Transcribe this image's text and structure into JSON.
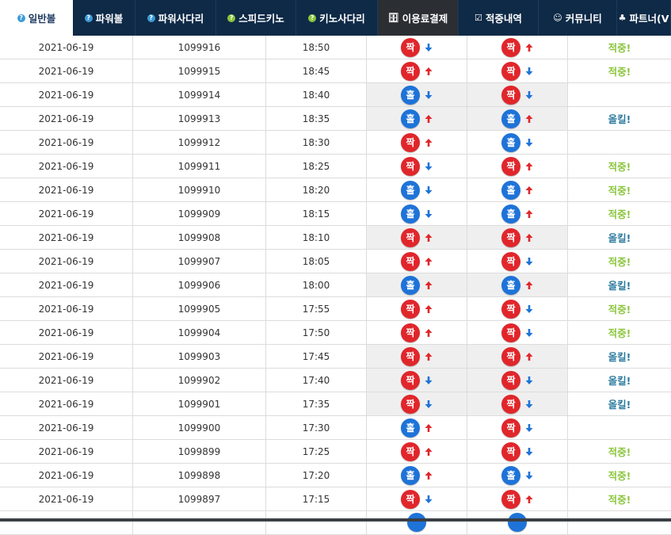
{
  "nav": {
    "tabs": [
      {
        "label": "일반볼",
        "icon": "help-circle-icon",
        "glyph": "?",
        "style": "active"
      },
      {
        "label": "파워볼",
        "icon": "help-circle-icon",
        "glyph": "?",
        "style": "normal"
      },
      {
        "label": "파워사다리",
        "icon": "help-circle-icon",
        "glyph": "?",
        "style": "normal"
      },
      {
        "label": "스피드키노",
        "icon": "help-circle-icon",
        "glyph": "?",
        "style": "normal"
      },
      {
        "label": "키노사다리",
        "icon": "help-circle-icon",
        "glyph": "?",
        "style": "normal"
      },
      {
        "label": "이용료결제",
        "icon": "database-icon",
        "glyph": "🗄",
        "style": "dark"
      },
      {
        "label": "적중내역",
        "icon": "checkbox-icon",
        "glyph": "☑",
        "style": "normal"
      },
      {
        "label": "커뮤니티",
        "icon": "smiley-icon",
        "glyph": "☺",
        "style": "normal"
      },
      {
        "label": "파트너(V",
        "icon": "group-icon",
        "glyph": "♣",
        "style": "normal"
      }
    ]
  },
  "rows": [
    {
      "date": "2021-06-19",
      "round": "1099916",
      "time": "18:50",
      "p1": "짝",
      "p1_color": "red",
      "p1_arrow": "down",
      "p2": "짝",
      "p2_color": "red",
      "p2_arrow": "up",
      "result": "적중!",
      "result_type": "hit",
      "shaded": false
    },
    {
      "date": "2021-06-19",
      "round": "1099915",
      "time": "18:45",
      "p1": "짝",
      "p1_color": "red",
      "p1_arrow": "up",
      "p2": "짝",
      "p2_color": "red",
      "p2_arrow": "down",
      "result": "적중!",
      "result_type": "hit",
      "shaded": false
    },
    {
      "date": "2021-06-19",
      "round": "1099914",
      "time": "18:40",
      "p1": "홀",
      "p1_color": "blue",
      "p1_arrow": "down",
      "p2": "짝",
      "p2_color": "red",
      "p2_arrow": "down",
      "result": "",
      "result_type": "none",
      "shaded": true
    },
    {
      "date": "2021-06-19",
      "round": "1099913",
      "time": "18:35",
      "p1": "홀",
      "p1_color": "blue",
      "p1_arrow": "up",
      "p2": "홀",
      "p2_color": "blue",
      "p2_arrow": "up",
      "result": "올킬!",
      "result_type": "allkill",
      "shaded": true
    },
    {
      "date": "2021-06-19",
      "round": "1099912",
      "time": "18:30",
      "p1": "짝",
      "p1_color": "red",
      "p1_arrow": "up",
      "p2": "홀",
      "p2_color": "blue",
      "p2_arrow": "down",
      "result": "",
      "result_type": "none",
      "shaded": false
    },
    {
      "date": "2021-06-19",
      "round": "1099911",
      "time": "18:25",
      "p1": "짝",
      "p1_color": "red",
      "p1_arrow": "down",
      "p2": "짝",
      "p2_color": "red",
      "p2_arrow": "up",
      "result": "적중!",
      "result_type": "hit",
      "shaded": false
    },
    {
      "date": "2021-06-19",
      "round": "1099910",
      "time": "18:20",
      "p1": "홀",
      "p1_color": "blue",
      "p1_arrow": "down",
      "p2": "홀",
      "p2_color": "blue",
      "p2_arrow": "up",
      "result": "적중!",
      "result_type": "hit",
      "shaded": false
    },
    {
      "date": "2021-06-19",
      "round": "1099909",
      "time": "18:15",
      "p1": "홀",
      "p1_color": "blue",
      "p1_arrow": "down",
      "p2": "홀",
      "p2_color": "blue",
      "p2_arrow": "up",
      "result": "적중!",
      "result_type": "hit",
      "shaded": false
    },
    {
      "date": "2021-06-19",
      "round": "1099908",
      "time": "18:10",
      "p1": "짝",
      "p1_color": "red",
      "p1_arrow": "up",
      "p2": "짝",
      "p2_color": "red",
      "p2_arrow": "up",
      "result": "올킬!",
      "result_type": "allkill",
      "shaded": true
    },
    {
      "date": "2021-06-19",
      "round": "1099907",
      "time": "18:05",
      "p1": "짝",
      "p1_color": "red",
      "p1_arrow": "up",
      "p2": "짝",
      "p2_color": "red",
      "p2_arrow": "down",
      "result": "적중!",
      "result_type": "hit",
      "shaded": false
    },
    {
      "date": "2021-06-19",
      "round": "1099906",
      "time": "18:00",
      "p1": "홀",
      "p1_color": "blue",
      "p1_arrow": "up",
      "p2": "홀",
      "p2_color": "blue",
      "p2_arrow": "up",
      "result": "올킬!",
      "result_type": "allkill",
      "shaded": true
    },
    {
      "date": "2021-06-19",
      "round": "1099905",
      "time": "17:55",
      "p1": "짝",
      "p1_color": "red",
      "p1_arrow": "up",
      "p2": "짝",
      "p2_color": "red",
      "p2_arrow": "down",
      "result": "적중!",
      "result_type": "hit",
      "shaded": false
    },
    {
      "date": "2021-06-19",
      "round": "1099904",
      "time": "17:50",
      "p1": "짝",
      "p1_color": "red",
      "p1_arrow": "up",
      "p2": "짝",
      "p2_color": "red",
      "p2_arrow": "down",
      "result": "적중!",
      "result_type": "hit",
      "shaded": false
    },
    {
      "date": "2021-06-19",
      "round": "1099903",
      "time": "17:45",
      "p1": "짝",
      "p1_color": "red",
      "p1_arrow": "up",
      "p2": "짝",
      "p2_color": "red",
      "p2_arrow": "up",
      "result": "올킬!",
      "result_type": "allkill",
      "shaded": true
    },
    {
      "date": "2021-06-19",
      "round": "1099902",
      "time": "17:40",
      "p1": "짝",
      "p1_color": "red",
      "p1_arrow": "down",
      "p2": "짝",
      "p2_color": "red",
      "p2_arrow": "down",
      "result": "올킬!",
      "result_type": "allkill",
      "shaded": true
    },
    {
      "date": "2021-06-19",
      "round": "1099901",
      "time": "17:35",
      "p1": "짝",
      "p1_color": "red",
      "p1_arrow": "down",
      "p2": "짝",
      "p2_color": "red",
      "p2_arrow": "down",
      "result": "올킬!",
      "result_type": "allkill",
      "shaded": true
    },
    {
      "date": "2021-06-19",
      "round": "1099900",
      "time": "17:30",
      "p1": "홀",
      "p1_color": "blue",
      "p1_arrow": "up",
      "p2": "짝",
      "p2_color": "red",
      "p2_arrow": "down",
      "result": "",
      "result_type": "none",
      "shaded": false
    },
    {
      "date": "2021-06-19",
      "round": "1099899",
      "time": "17:25",
      "p1": "짝",
      "p1_color": "red",
      "p1_arrow": "up",
      "p2": "짝",
      "p2_color": "red",
      "p2_arrow": "down",
      "result": "적중!",
      "result_type": "hit",
      "shaded": false
    },
    {
      "date": "2021-06-19",
      "round": "1099898",
      "time": "17:20",
      "p1": "홀",
      "p1_color": "blue",
      "p1_arrow": "up",
      "p2": "홀",
      "p2_color": "blue",
      "p2_arrow": "down",
      "result": "적중!",
      "result_type": "hit",
      "shaded": false
    },
    {
      "date": "2021-06-19",
      "round": "1099897",
      "time": "17:15",
      "p1": "짝",
      "p1_color": "red",
      "p1_arrow": "down",
      "p2": "짝",
      "p2_color": "red",
      "p2_arrow": "up",
      "result": "적중!",
      "result_type": "hit",
      "shaded": false
    },
    {
      "date": "",
      "round": "",
      "time": "",
      "p1": "",
      "p1_color": "blue",
      "p1_arrow": "",
      "p2": "",
      "p2_color": "blue",
      "p2_arrow": "",
      "result": "",
      "result_type": "none",
      "shaded": false
    }
  ],
  "colors": {
    "nav_bg": "#0e2a47",
    "ball_red": "#e0262b",
    "ball_blue": "#1e73d8",
    "arrow_up": "#e0262b",
    "arrow_down": "#1e73d8",
    "hit": "#8cc63e",
    "allkill": "#2b7a9e"
  }
}
